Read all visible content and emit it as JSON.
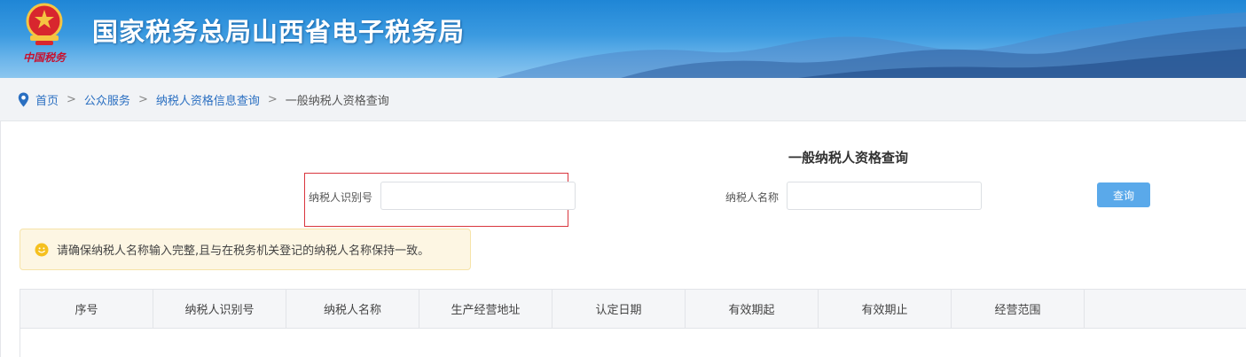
{
  "header": {
    "site_title": "国家税务总局山西省电子税务局",
    "emblem_signature": "中国税务"
  },
  "breadcrumb": {
    "items": [
      "首页",
      "公众服务",
      "纳税人资格信息查询"
    ],
    "separator": ">",
    "current": "一般纳税人资格查询"
  },
  "form": {
    "title": "一般纳税人资格查询",
    "taxpayer_id_label": "纳税人识别号",
    "taxpayer_id_value": "",
    "taxpayer_name_label": "纳税人名称",
    "taxpayer_name_value": "",
    "query_button": "查询"
  },
  "notice": {
    "text": "请确保纳税人名称输入完整,且与在税务机关登记的纳税人名称保持一致。"
  },
  "table": {
    "columns": [
      "序号",
      "纳税人识别号",
      "纳税人名称",
      "生产经营地址",
      "认定日期",
      "有效期起",
      "有效期止",
      "经营范围",
      ""
    ],
    "rows": []
  },
  "colors": {
    "header_blue": "#1f86d6",
    "link_blue": "#2a6fc1",
    "button_blue": "#5aa9ea",
    "highlight_red": "#d9363e",
    "notice_bg": "#fdf6e3"
  }
}
